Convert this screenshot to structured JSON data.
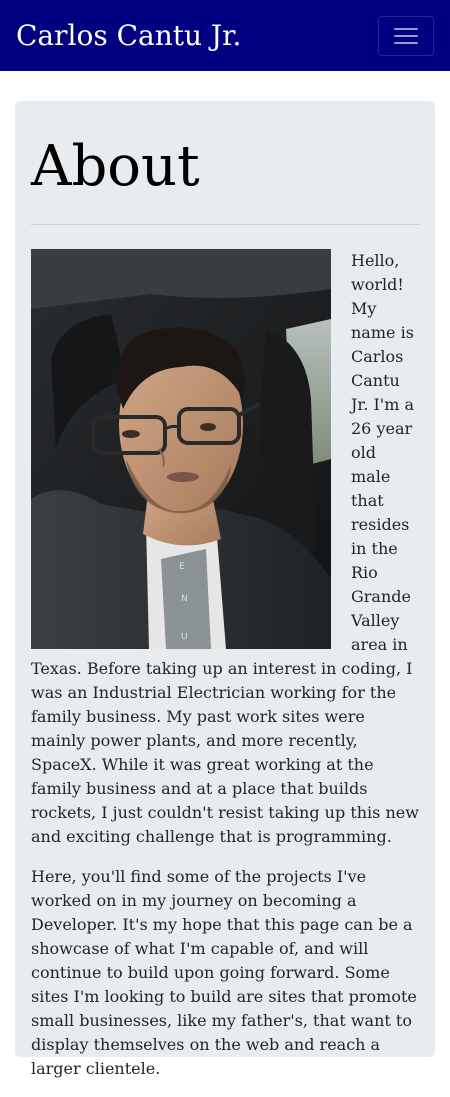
{
  "navbar": {
    "brand": "Carlos Cantu Jr.",
    "toggle_icon": "hamburger-icon"
  },
  "about": {
    "title": "About",
    "photo_icon": "profile-photo",
    "paragraph1": "Hello, world! My name is Carlos Cantu Jr. I'm a 26 year old male that resides in the Rio Grande Valley area in Texas. Before taking up an interest in coding, I was an Industrial Electrician working for the family business. My past work sites were mainly power plants, and more recently, SpaceX. While it was great working at the family business and at a place that builds rockets, I just couldn't resist taking up this new and exciting challenge that is programming.",
    "paragraph2": "Here, you'll find some of the projects I've worked on in my journey on becoming a Developer. It's my hope that this page can be a showcase of what I'm capable of, and will continue to build upon going forward. Some sites I'm looking to build are sites that promote small businesses, like my father's, that want to display themselves on the web and reach a larger clientele."
  },
  "colors": {
    "navbar_bg": "#000080",
    "card_bg": "#e9ecef"
  }
}
